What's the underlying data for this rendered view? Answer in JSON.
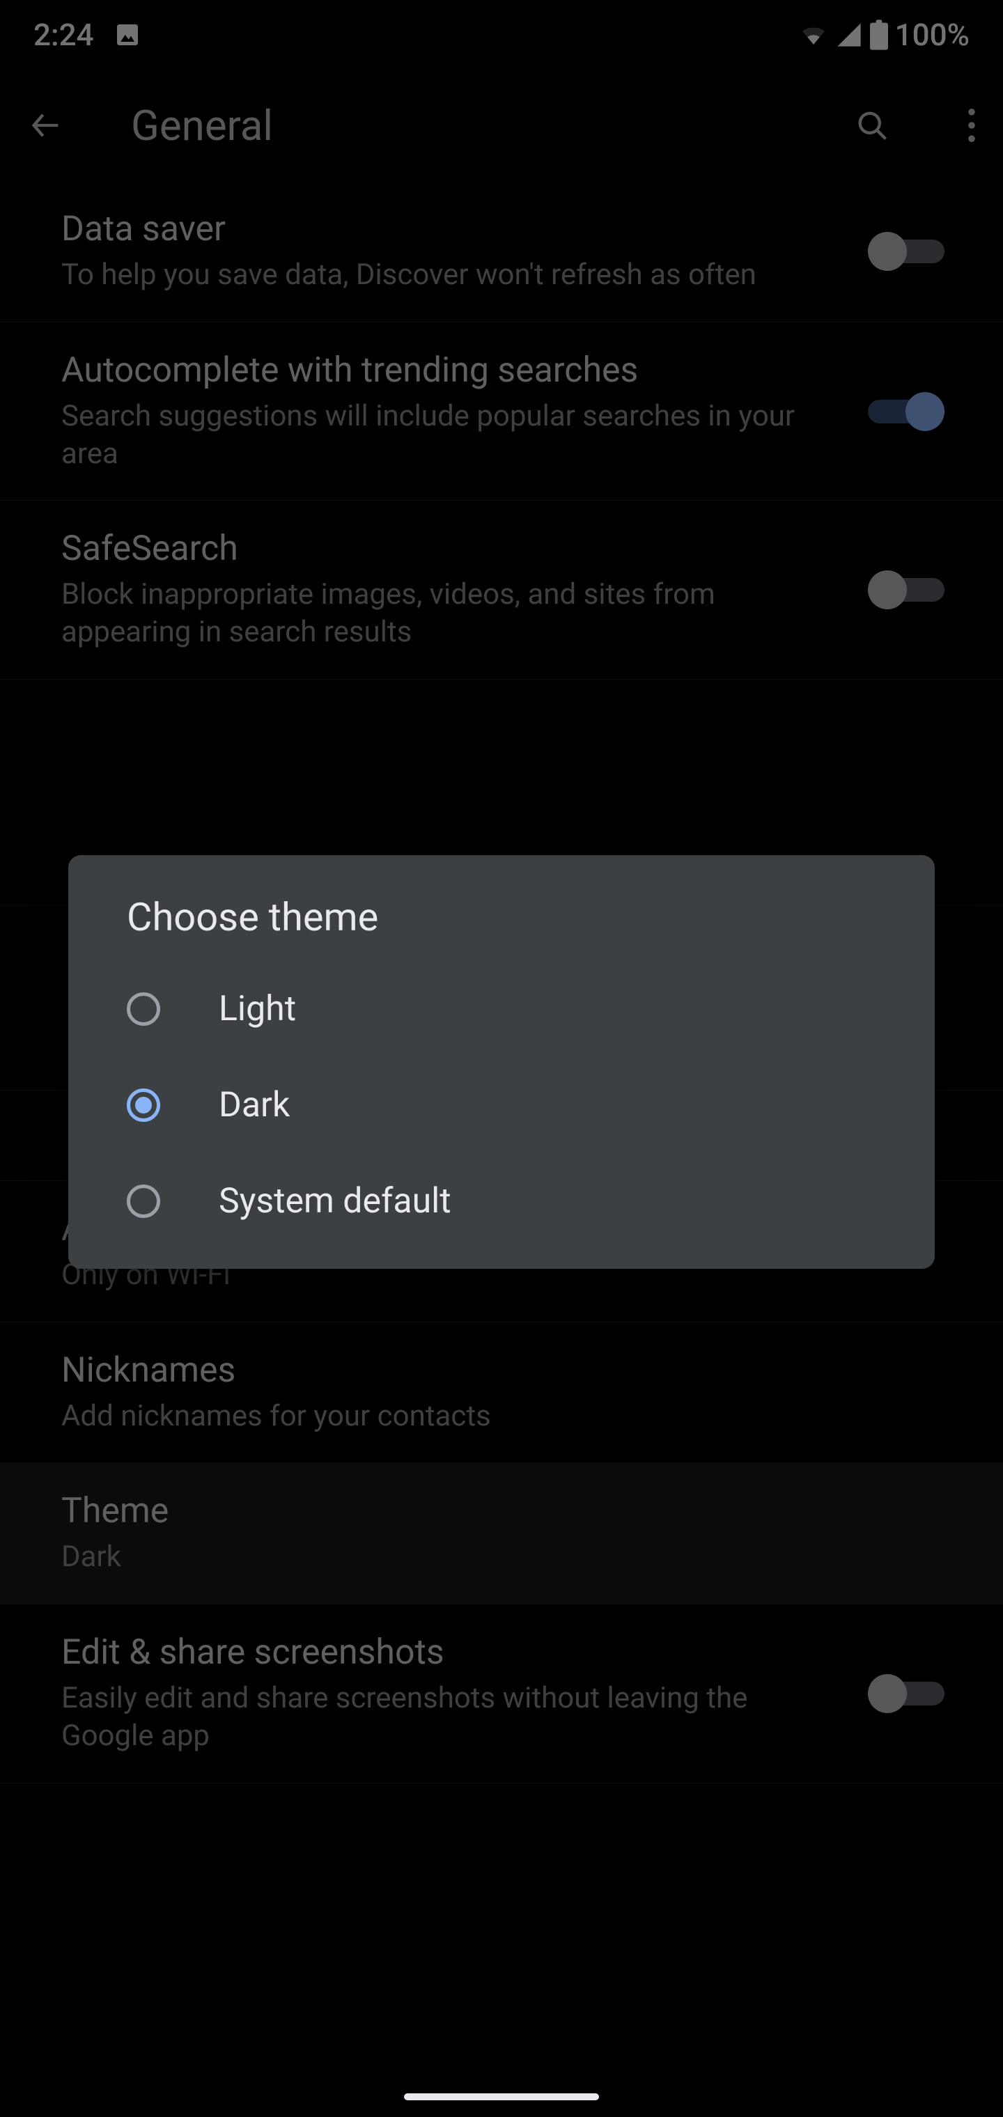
{
  "status": {
    "time": "2:24",
    "battery": "100%"
  },
  "header": {
    "title": "General"
  },
  "settings": {
    "data_saver": {
      "title": "Data saver",
      "sub": "To help you save data, Discover won't refresh as often"
    },
    "autocomplete": {
      "title": "Autocomplete with trending searches",
      "sub": "Search suggestions will include popular searches in your area"
    },
    "safesearch": {
      "title": "SafeSearch",
      "sub": "Block inappropriate images, videos, and sites from appearing in search results"
    },
    "autoplay": {
      "title": "Autoplay video previews",
      "sub": "Only on Wi-Fi"
    },
    "nicknames": {
      "title": "Nicknames",
      "sub": "Add nicknames for your contacts"
    },
    "theme": {
      "title": "Theme",
      "sub": "Dark"
    },
    "screenshots": {
      "title": "Edit & share screenshots",
      "sub": "Easily edit and share screenshots without leaving the Google app"
    }
  },
  "dialog": {
    "title": "Choose theme",
    "options": {
      "light": "Light",
      "dark": "Dark",
      "system": "System default"
    }
  }
}
